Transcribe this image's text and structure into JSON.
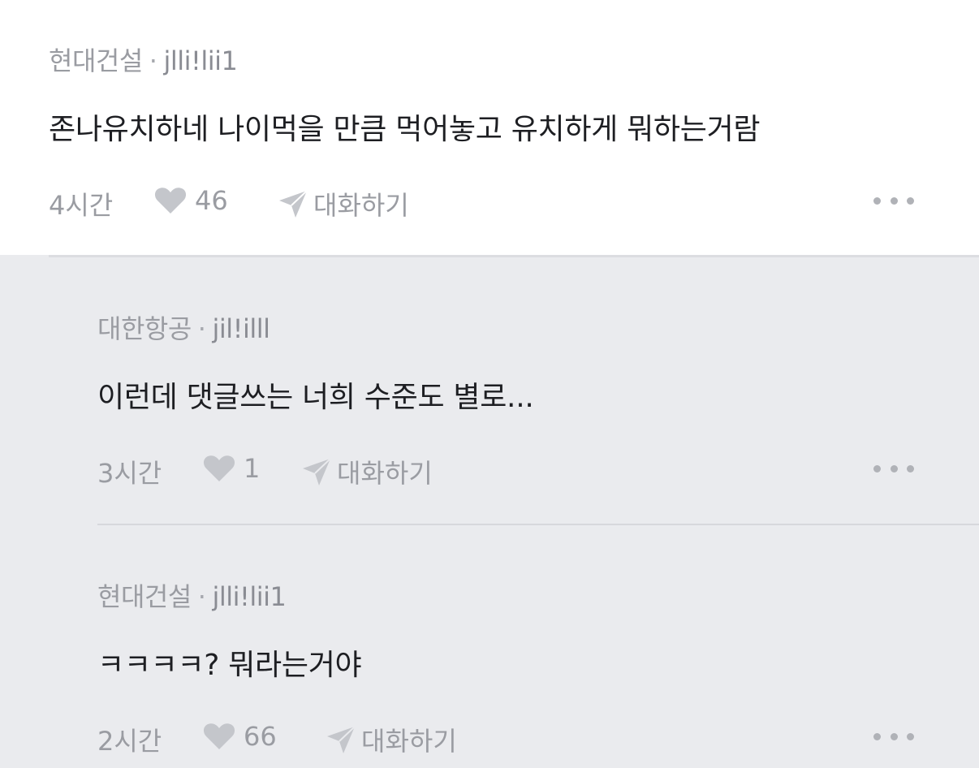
{
  "comments": [
    {
      "company": "현대건설",
      "separator": "·",
      "user": "jlli!lii1",
      "text": "존나유치하네 나이먹을 만큼 먹어놓고 유치하게 뭐하는거람",
      "time": "4시간",
      "likes": "46",
      "reply_label": "대화하기"
    },
    {
      "company": "대한항공",
      "separator": "·",
      "user": "jil!illl",
      "text": "이런데 댓글쓰는 너희 수준도 별로...",
      "time": "3시간",
      "likes": "1",
      "reply_label": "대화하기"
    },
    {
      "company": "현대건설",
      "separator": "·",
      "user": "jlli!lii1",
      "text": "ㅋㅋㅋㅋ? 뭐라는거야",
      "time": "2시간",
      "likes": "66",
      "reply_label": "대화하기"
    }
  ],
  "icons": {
    "like": "heart-icon",
    "reply": "send-icon",
    "more": "more-options-icon"
  },
  "colors": {
    "meta_text": "#9a9ca2",
    "body_text": "#1d1e22",
    "reply_background": "#eaebee",
    "icon_fill": "#c4c6cb"
  }
}
